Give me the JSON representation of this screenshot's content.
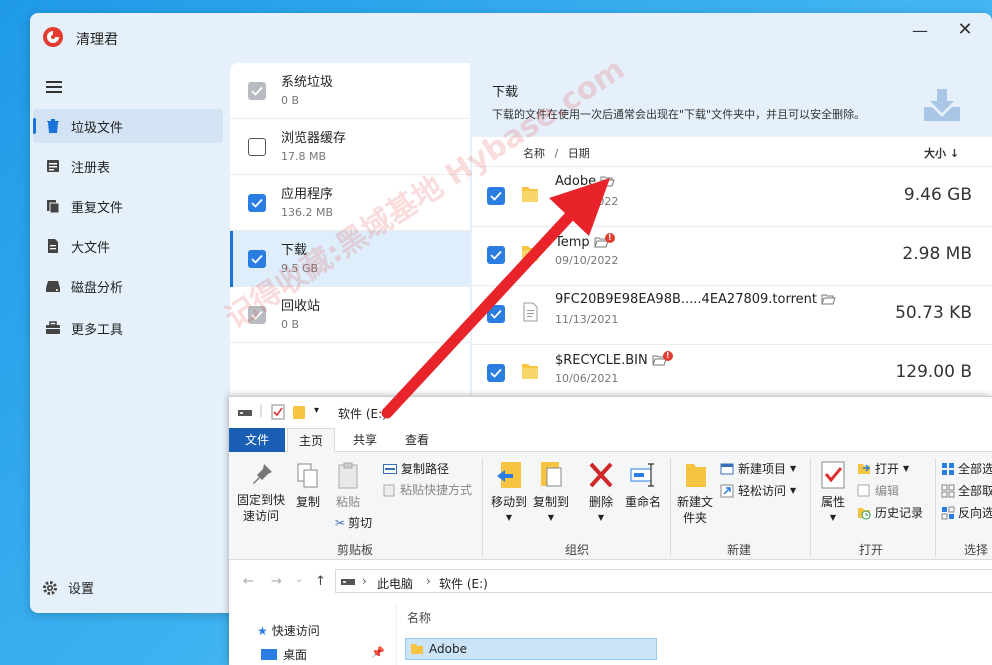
{
  "app": {
    "title": "清理君",
    "minimize_glyph": "—",
    "close_glyph": "✕",
    "nav": [
      {
        "label": "垃圾文件",
        "icon": "trash-icon",
        "active": true
      },
      {
        "label": "注册表",
        "icon": "registry-icon",
        "active": false
      },
      {
        "label": "重复文件",
        "icon": "duplicate-files-icon",
        "active": false
      },
      {
        "label": "大文件",
        "icon": "large-file-icon",
        "active": false
      },
      {
        "label": "磁盘分析",
        "icon": "disk-analysis-icon",
        "active": false
      },
      {
        "label": "更多工具",
        "icon": "toolbox-icon",
        "active": false
      }
    ],
    "settings_label": "设置",
    "categories": [
      {
        "name": "系统垃圾",
        "size": "0 B",
        "check": "gray"
      },
      {
        "name": "浏览器缓存",
        "size": "17.8 MB",
        "check": "off"
      },
      {
        "name": "应用程序",
        "size": "136.2 MB",
        "check": "on"
      },
      {
        "name": "下载",
        "size": "9.5 GB",
        "check": "on",
        "selected": true
      },
      {
        "name": "回收站",
        "size": "0 B",
        "check": "gray"
      }
    ],
    "detail": {
      "title": "下载",
      "description": "下载的文件在使用一次后通常会出现在\"下载\"文件夹中，并且可以安全删除。",
      "col_name": "名称",
      "col_sep": "/",
      "col_date": "日期",
      "col_size": "大小 ↓",
      "files": [
        {
          "name": "Adobe",
          "date": "10/09/2022",
          "size": "9.46 GB",
          "type": "folder",
          "warn": false
        },
        {
          "name": "Temp",
          "date": "09/10/2022",
          "size": "2.98 MB",
          "type": "folder",
          "warn": true
        },
        {
          "name": "9FC20B9E98EA98B.....4EA27809.torrent",
          "date": "11/13/2021",
          "size": "50.73 KB",
          "type": "file",
          "warn": false
        },
        {
          "name": "$RECYCLE.BIN",
          "date": "10/06/2021",
          "size": "129.00 B",
          "type": "folder",
          "warn": true
        }
      ]
    },
    "watermark": "记得收藏:黑域基地 Hybase.com"
  },
  "explorer": {
    "title": "软件 (E:)",
    "tabs": {
      "file": "文件",
      "home": "主页",
      "share": "共享",
      "view": "查看"
    },
    "clipboard": {
      "pin": "固定到快速访问",
      "copy": "复制",
      "paste": "粘贴",
      "copy_path": "复制路径",
      "paste_shortcut": "粘贴快捷方式",
      "cut": "剪切",
      "group": "剪贴板"
    },
    "organize": {
      "move_to": "移动到",
      "copy_to": "复制到",
      "delete": "删除",
      "rename": "重命名",
      "group": "组织"
    },
    "new": {
      "new_folder": "新建文件夹",
      "new_item": "新建项目",
      "easy_access": "轻松访问",
      "group": "新建"
    },
    "open": {
      "properties": "属性",
      "open": "打开",
      "edit": "编辑",
      "history": "历史记录",
      "group": "打开"
    },
    "select": {
      "select_all": "全部选",
      "select_none": "全部取",
      "invert": "反向选",
      "group": "选择"
    },
    "address": {
      "pc": "此电脑",
      "drive": "软件 (E:)"
    },
    "nav_pane": {
      "quick_access": "快速访问",
      "desktop": "桌面"
    },
    "content": {
      "col_name": "名称",
      "first_item": "Adobe"
    }
  },
  "colors": {
    "accent": "#2a7de1",
    "arrow": "#e8232a",
    "folder": "#f5c542",
    "warn": "#e03c31"
  }
}
